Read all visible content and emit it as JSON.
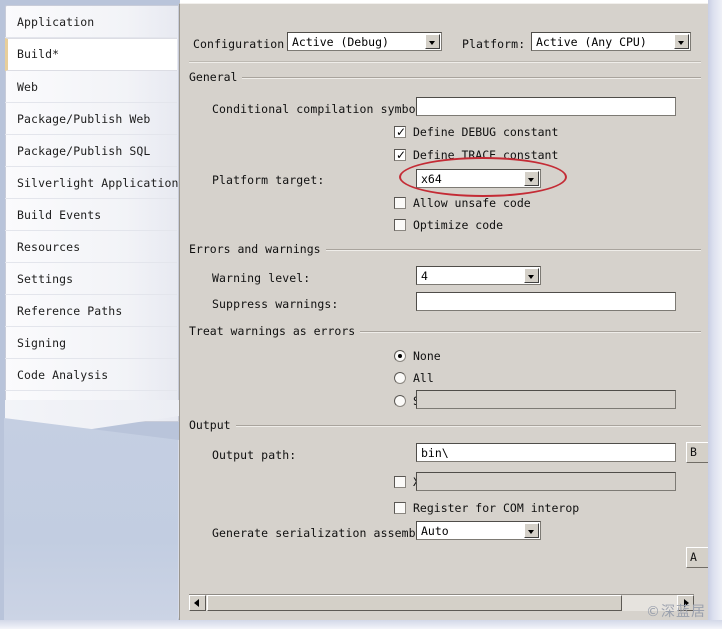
{
  "window": {
    "watermark": "©深蓝居"
  },
  "sidebar": {
    "items": [
      {
        "label": "Application",
        "selected": false
      },
      {
        "label": "Build*",
        "selected": true
      },
      {
        "label": "Web",
        "selected": false
      },
      {
        "label": "Package/Publish Web",
        "selected": false
      },
      {
        "label": "Package/Publish SQL",
        "selected": false
      },
      {
        "label": "Silverlight Applications",
        "selected": false
      },
      {
        "label": "Build Events",
        "selected": false
      },
      {
        "label": "Resources",
        "selected": false
      },
      {
        "label": "Settings",
        "selected": false
      },
      {
        "label": "Reference Paths",
        "selected": false
      },
      {
        "label": "Signing",
        "selected": false
      },
      {
        "label": "Code Analysis",
        "selected": false
      }
    ]
  },
  "toolbar": {
    "configuration_label": "Configuration:",
    "configuration_value": "Active (Debug)",
    "platform_label": "Platform:",
    "platform_value": "Active (Any CPU)"
  },
  "general": {
    "header": "General",
    "conditional_symbols_label": "Conditional compilation symbols:",
    "conditional_symbols_value": "",
    "define_debug_label": "Define DEBUG constant",
    "define_debug_checked": true,
    "define_trace_label": "Define TRACE constant",
    "define_trace_checked": true,
    "platform_target_label": "Platform target:",
    "platform_target_value": "x64",
    "allow_unsafe_label": "Allow unsafe code",
    "allow_unsafe_checked": false,
    "optimize_label": "Optimize code",
    "optimize_checked": false
  },
  "errors_warnings": {
    "header": "Errors and warnings",
    "warning_level_label": "Warning level:",
    "warning_level_value": "4",
    "suppress_warnings_label": "Suppress warnings:",
    "suppress_warnings_value": ""
  },
  "treat_warnings": {
    "header": "Treat warnings as errors",
    "none_label": "None",
    "all_label": "All",
    "specific_label": "Specific warnings:",
    "specific_value": "",
    "selected": "None"
  },
  "output": {
    "header": "Output",
    "output_path_label": "Output path:",
    "output_path_value": "bin\\",
    "browse_button_label": "B",
    "xml_doc_label": "XML documentation file:",
    "xml_doc_checked": false,
    "xml_doc_value": "",
    "register_com_label": "Register for COM interop",
    "register_com_checked": false,
    "serialization_label": "Generate serialization assembly:",
    "serialization_value": "Auto",
    "advanced_button_label": "A"
  },
  "scrollbar": {
    "left_arrow": "left-arrow",
    "right_arrow": "right-arrow"
  },
  "annotation": {
    "ellipse_color": "#c42b35",
    "target": "platform-target-combo"
  },
  "colors": {
    "panel_bg": "#d6d2cc",
    "sidebar_page": "#f5f6fa",
    "sidebar_lower": "#c5cfe2",
    "selected_item_bg": "#ffffff",
    "selected_item_accent": "#e8cf9b",
    "annotation_red": "#c42b35"
  }
}
